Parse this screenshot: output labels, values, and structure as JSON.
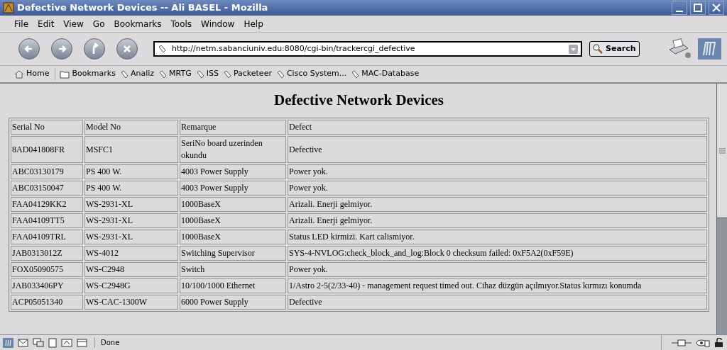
{
  "window": {
    "title": "Defective Network Devices -- Ali BASEL - Mozilla"
  },
  "menu": [
    "File",
    "Edit",
    "View",
    "Go",
    "Bookmarks",
    "Tools",
    "Window",
    "Help"
  ],
  "address": {
    "value": "http://netm.sabanciuniv.edu:8080/cgi-bin/trackercgi_defective"
  },
  "search_button": "Search",
  "bookmarks": [
    {
      "kind": "home",
      "label": "Home"
    },
    {
      "kind": "folder",
      "label": "Bookmarks"
    },
    {
      "kind": "link",
      "label": "Analiz"
    },
    {
      "kind": "link",
      "label": "MRTG"
    },
    {
      "kind": "link",
      "label": "ISS"
    },
    {
      "kind": "link",
      "label": "Packeteer"
    },
    {
      "kind": "link",
      "label": "Cisco System..."
    },
    {
      "kind": "link",
      "label": "MAC-Database"
    }
  ],
  "page": {
    "heading": "Defective Network Devices",
    "table": {
      "columns": [
        "Serial No",
        "Model No",
        "Remarque",
        "Defect"
      ],
      "rows": [
        [
          "8AD041808FR",
          "MSFC1",
          "SeriNo board uzerinden okundu",
          "Defective"
        ],
        [
          "ABC03130179",
          "PS 400 W.",
          "4003 Power Supply",
          "Power yok."
        ],
        [
          "ABC03150047",
          "PS 400 W.",
          "4003 Power Supply",
          "Power yok."
        ],
        [
          "FAA04129KK2",
          "WS-2931-XL",
          "1000BaseX",
          "Arizali. Enerji gelmiyor."
        ],
        [
          "FAA04109TT5",
          "WS-2931-XL",
          "1000BaseX",
          "Arizali. Enerji gelmiyor."
        ],
        [
          "FAA04109TRL",
          "WS-2931-XL",
          "1000BaseX",
          "Status LED kirmizi. Kart calismiyor."
        ],
        [
          "JAB0313012Z",
          "WS-4012",
          "Switching Supervisor",
          "SYS-4-NVLOG:check_block_and_log:Block 0 checksum failed: 0xF5A2(0xF59E)"
        ],
        [
          "FOX05090575",
          "WS-C2948",
          "Switch",
          "Power yok."
        ],
        [
          "JAB033406PY",
          "WS-C2948G",
          "10/100/1000 Ethernet",
          "1/Astro 2-5(2/33-40) - management request timed out. Cihaz düzgün açılmıyor.Status kırmızı konumda"
        ],
        [
          "ACP05051340",
          "WS-CAC-1300W",
          "6000 Power Supply",
          "Defective"
        ]
      ]
    }
  },
  "status_bar": {
    "text": "Done"
  }
}
